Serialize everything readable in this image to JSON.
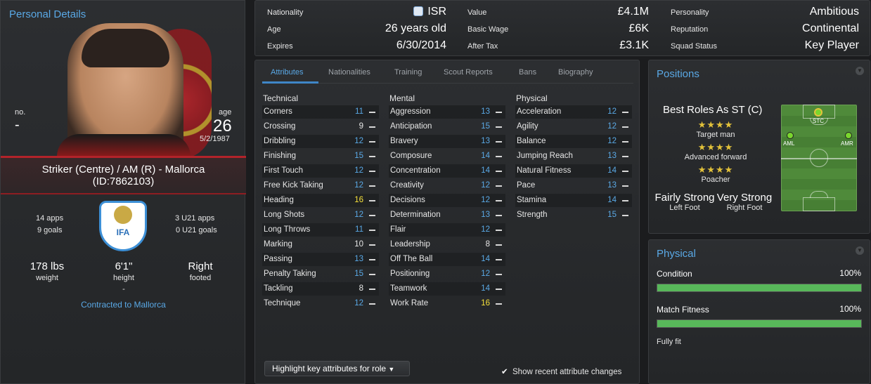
{
  "personal": {
    "title": "Personal Details",
    "no_label": "no.",
    "no_value": "-",
    "age_label": "age",
    "age_value": "26",
    "dob": "5/2/1987",
    "role": "Striker (Centre) / AM (R) - Mallorca",
    "id": "(ID:7862103)",
    "apps": "14 apps",
    "goals": "9 goals",
    "u21_apps": "3 U21 apps",
    "u21_goals": "0 U21 goals",
    "badge_text": "IFA",
    "weight_value": "178 lbs",
    "weight_label": "weight",
    "height_value": "6'1\"",
    "height_label": "height",
    "footed_value": "Right",
    "footed_label": "footed",
    "dash": "-",
    "contract_link": "Contracted to Mallorca"
  },
  "info": {
    "nationality_label": "Nationality",
    "nationality_value": "ISR",
    "age_label": "Age",
    "age_value": "26 years old",
    "expires_label": "Expires",
    "expires_value": "6/30/2014",
    "value_label": "Value",
    "value_value": "£4.1M",
    "wage_label": "Basic Wage",
    "wage_value": "£6K",
    "aftertax_label": "After Tax",
    "aftertax_value": "£3.1K",
    "personality_label": "Personality",
    "personality_value": "Ambitious",
    "reputation_label": "Reputation",
    "reputation_value": "Continental",
    "squad_label": "Squad Status",
    "squad_value": "Key Player"
  },
  "tabs": [
    "Attributes",
    "Nationalities",
    "Training",
    "Scout Reports",
    "Bans",
    "Biography"
  ],
  "attributes": {
    "technical_title": "Technical",
    "mental_title": "Mental",
    "physical_title": "Physical",
    "highlight_color": "#f5e03a",
    "normal_color": "#5aa9e6",
    "plain_color": "#e6e6e6",
    "technical": [
      {
        "name": "Corners",
        "value": "11"
      },
      {
        "name": "Crossing",
        "value": "9"
      },
      {
        "name": "Dribbling",
        "value": "12"
      },
      {
        "name": "Finishing",
        "value": "15"
      },
      {
        "name": "First Touch",
        "value": "12"
      },
      {
        "name": "Free Kick Taking",
        "value": "12"
      },
      {
        "name": "Heading",
        "value": "16"
      },
      {
        "name": "Long Shots",
        "value": "12"
      },
      {
        "name": "Long Throws",
        "value": "11"
      },
      {
        "name": "Marking",
        "value": "10"
      },
      {
        "name": "Passing",
        "value": "13"
      },
      {
        "name": "Penalty Taking",
        "value": "15"
      },
      {
        "name": "Tackling",
        "value": "8"
      },
      {
        "name": "Technique",
        "value": "12"
      }
    ],
    "mental": [
      {
        "name": "Aggression",
        "value": "13"
      },
      {
        "name": "Anticipation",
        "value": "15"
      },
      {
        "name": "Bravery",
        "value": "13"
      },
      {
        "name": "Composure",
        "value": "14"
      },
      {
        "name": "Concentration",
        "value": "14"
      },
      {
        "name": "Creativity",
        "value": "12"
      },
      {
        "name": "Decisions",
        "value": "12"
      },
      {
        "name": "Determination",
        "value": "13"
      },
      {
        "name": "Flair",
        "value": "12"
      },
      {
        "name": "Leadership",
        "value": "8"
      },
      {
        "name": "Off The Ball",
        "value": "14"
      },
      {
        "name": "Positioning",
        "value": "12"
      },
      {
        "name": "Teamwork",
        "value": "14"
      },
      {
        "name": "Work Rate",
        "value": "16"
      }
    ],
    "physical": [
      {
        "name": "Acceleration",
        "value": "12"
      },
      {
        "name": "Agility",
        "value": "12"
      },
      {
        "name": "Balance",
        "value": "12"
      },
      {
        "name": "Jumping Reach",
        "value": "13"
      },
      {
        "name": "Natural Fitness",
        "value": "14"
      },
      {
        "name": "Pace",
        "value": "13"
      },
      {
        "name": "Stamina",
        "value": "14"
      },
      {
        "name": "Strength",
        "value": "15"
      }
    ],
    "highlight_button": "Highlight key attributes for role",
    "show_changes": "Show recent attribute changes"
  },
  "positions": {
    "title": "Positions",
    "best_roles": "Best Roles As ST (C)",
    "roles": [
      {
        "name": "Target man",
        "stars": "★★★★"
      },
      {
        "name": "Advanced forward",
        "stars": "★★★★"
      },
      {
        "name": "Poacher",
        "stars": "★★★★"
      }
    ],
    "left_foot_value": "Fairly Strong",
    "left_foot_label": "Left Foot",
    "right_foot_value": "Very Strong",
    "right_foot_label": "Right Foot",
    "pitch_positions": [
      "STC",
      "AML",
      "AMR"
    ]
  },
  "physical": {
    "title": "Physical",
    "condition_label": "Condition",
    "condition_value": "100%",
    "condition_fill": 1.0,
    "fitness_label": "Match Fitness",
    "fitness_value": "100%",
    "fitness_fill": 1.0,
    "status": "Fully fit"
  }
}
